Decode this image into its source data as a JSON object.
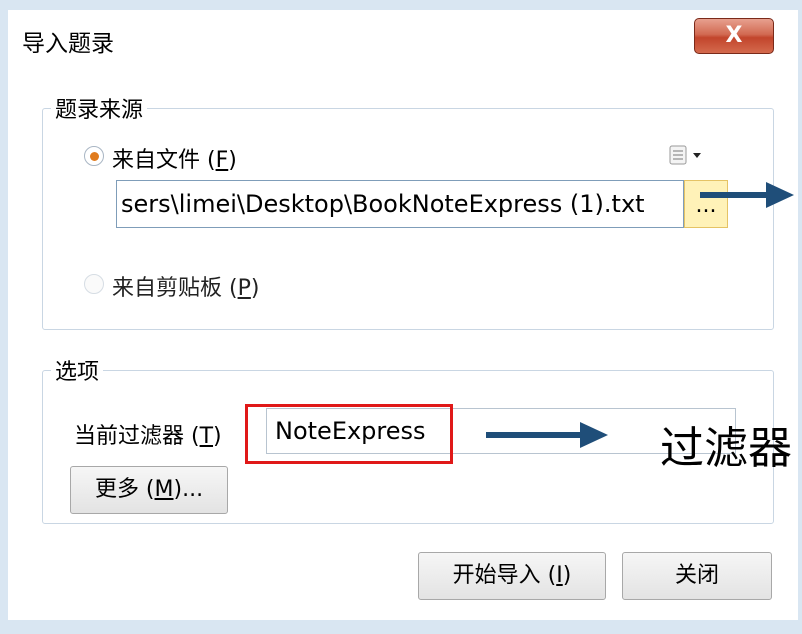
{
  "window": {
    "title": "导入题录",
    "close_glyph": "X"
  },
  "source_group": {
    "legend": "题录来源",
    "from_file_label_prefix": "来自文件 (",
    "from_file_accel": "F",
    "from_file_label_suffix": ")",
    "file_path": "sers\\limei\\Desktop\\BookNoteExpress (1).txt",
    "browse_label": "...",
    "from_clipboard_label_prefix": "来自剪贴板 (",
    "from_clipboard_accel": "P",
    "from_clipboard_label_suffix": ")",
    "selected": "file"
  },
  "options_group": {
    "legend": "选项",
    "filter_label_prefix": "当前过滤器 (",
    "filter_label_accel": "T",
    "filter_label_suffix": ")",
    "filter_value": "NoteExpress",
    "more_label_prefix": "更多 (",
    "more_label_accel": "M",
    "more_label_suffix": ")..."
  },
  "footer": {
    "start_label_prefix": "开始导入 (",
    "start_label_accel": "I",
    "start_label_suffix": ")",
    "close_label": "关闭"
  },
  "annotation": {
    "filter_caption": "过滤器",
    "arrow_color": "#1f4e79",
    "highlight_color": "#e01818"
  }
}
